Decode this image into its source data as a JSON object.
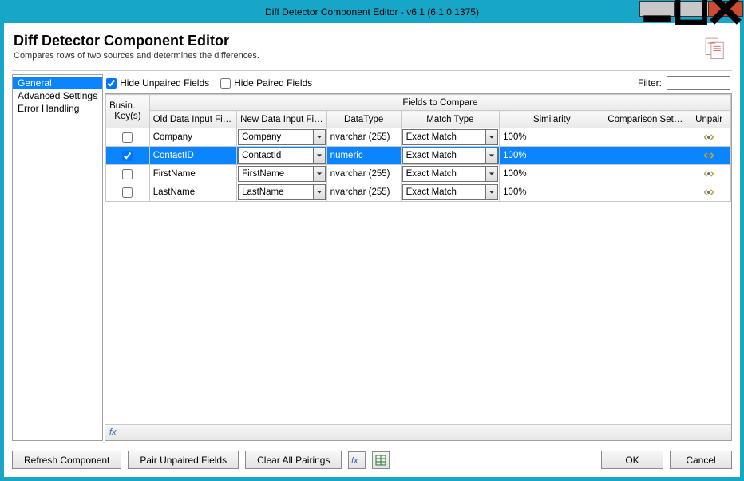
{
  "window": {
    "title": "Diff Detector Component Editor - v6.1 (6.1.0.1375)"
  },
  "header": {
    "title": "Diff Detector Component Editor",
    "subtitle": "Compares rows of two sources and determines the differences."
  },
  "sidebar": {
    "items": [
      {
        "label": "General",
        "selected": true
      },
      {
        "label": "Advanced Settings",
        "selected": false
      },
      {
        "label": "Error Handling",
        "selected": false
      }
    ]
  },
  "options": {
    "hide_unpaired_label": "Hide Unpaired Fields",
    "hide_unpaired_checked": true,
    "hide_paired_label": "Hide Paired Fields",
    "hide_paired_checked": false,
    "filter_label": "Filter:",
    "filter_value": ""
  },
  "table": {
    "header_group_left": "Business Key(s)",
    "header_group_right": "Fields to Compare",
    "columns": {
      "old": "Old Data Input Field",
      "new": "New Data Input Field",
      "datatype": "DataType",
      "matchtype": "Match Type",
      "similarity": "Similarity",
      "comparison": "Comparison Settings",
      "unpair": "Unpair"
    },
    "rows": [
      {
        "bk": false,
        "old": "Company",
        "new": "Company",
        "datatype": "nvarchar (255)",
        "matchtype": "Exact Match",
        "similarity": "100%",
        "selected": false
      },
      {
        "bk": true,
        "old": "ContactID",
        "new": "ContactId",
        "datatype": "numeric",
        "matchtype": "Exact Match",
        "similarity": "100%",
        "selected": true
      },
      {
        "bk": false,
        "old": "FirstName",
        "new": "FirstName",
        "datatype": "nvarchar (255)",
        "matchtype": "Exact Match",
        "similarity": "100%",
        "selected": false
      },
      {
        "bk": false,
        "old": "LastName",
        "new": "LastName",
        "datatype": "nvarchar (255)",
        "matchtype": "Exact Match",
        "similarity": "100%",
        "selected": false
      }
    ]
  },
  "buttons": {
    "refresh": "Refresh Component",
    "pair": "Pair Unpaired Fields",
    "clear": "Clear All Pairings",
    "ok": "OK",
    "cancel": "Cancel"
  }
}
